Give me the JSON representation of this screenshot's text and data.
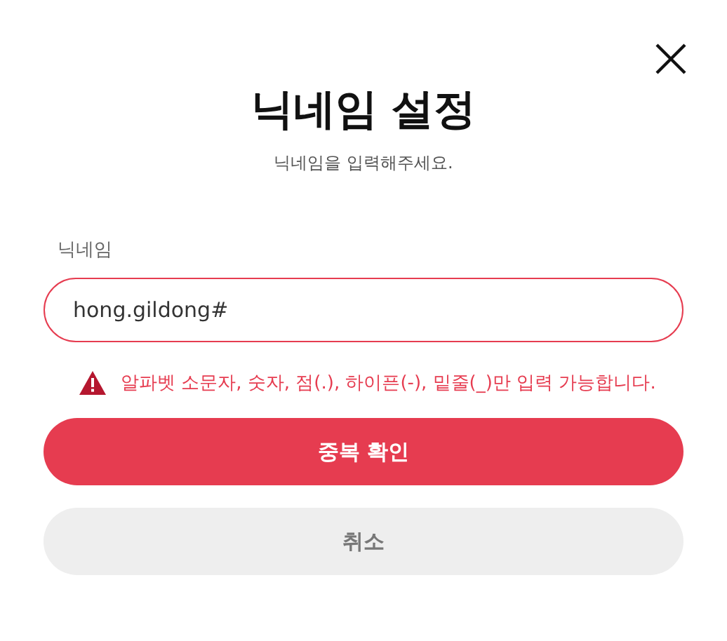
{
  "dialog": {
    "title": "닉네임 설정",
    "subtitle": "닉네임을 입력해주세요."
  },
  "field": {
    "label": "닉네임",
    "value": "hong.gildong#",
    "invalid": true
  },
  "error_message": "알파벳 소문자, 숫자, 점(.), 하이픈(-), 밑줄(_)만 입력 가능합니다.",
  "buttons": [
    {
      "label": "중복 확인",
      "kind": "primary"
    },
    {
      "label": "취소",
      "kind": "secondary"
    }
  ]
}
